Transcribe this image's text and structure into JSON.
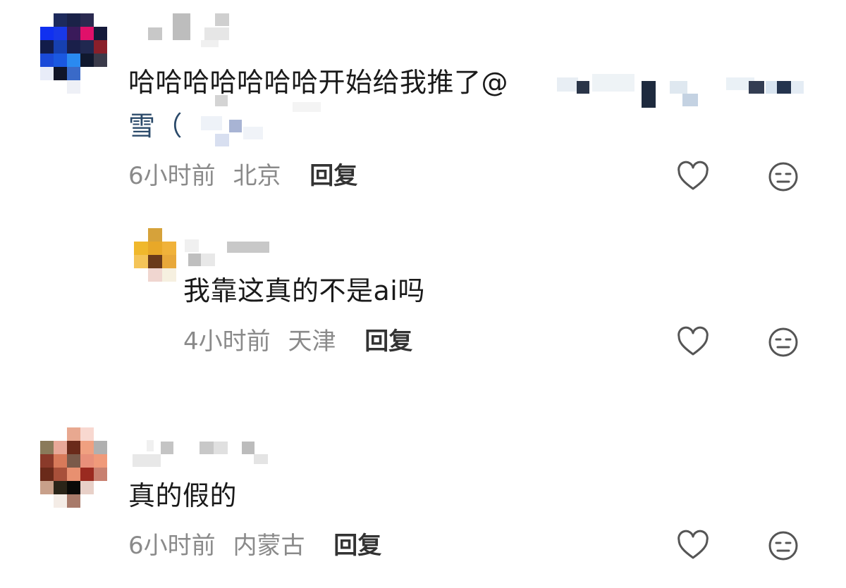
{
  "comments": [
    {
      "text": "哈哈哈哈哈哈哈开始给我推了",
      "mention_at": "@",
      "mention_continuation": "雪（",
      "time": "6小时前",
      "location": "北京",
      "reply_label": "回复",
      "like_icon": "heart-outline-icon",
      "dislike_icon": "meh-face-icon",
      "replies": [
        {
          "text": "我靠这真的不是ai吗",
          "time": "4小时前",
          "location": "天津",
          "reply_label": "回复",
          "like_icon": "heart-outline-icon",
          "dislike_icon": "meh-face-icon"
        }
      ]
    },
    {
      "text": "真的假的",
      "time": "6小时前",
      "location": "内蒙古",
      "reply_label": "回复",
      "like_icon": "heart-outline-icon",
      "dislike_icon": "meh-face-icon"
    }
  ],
  "colors": {
    "meta_text": "#8a8a8a",
    "reply_text": "#333333",
    "body_text": "#1a1a1a",
    "icon_stroke": "#555555"
  }
}
